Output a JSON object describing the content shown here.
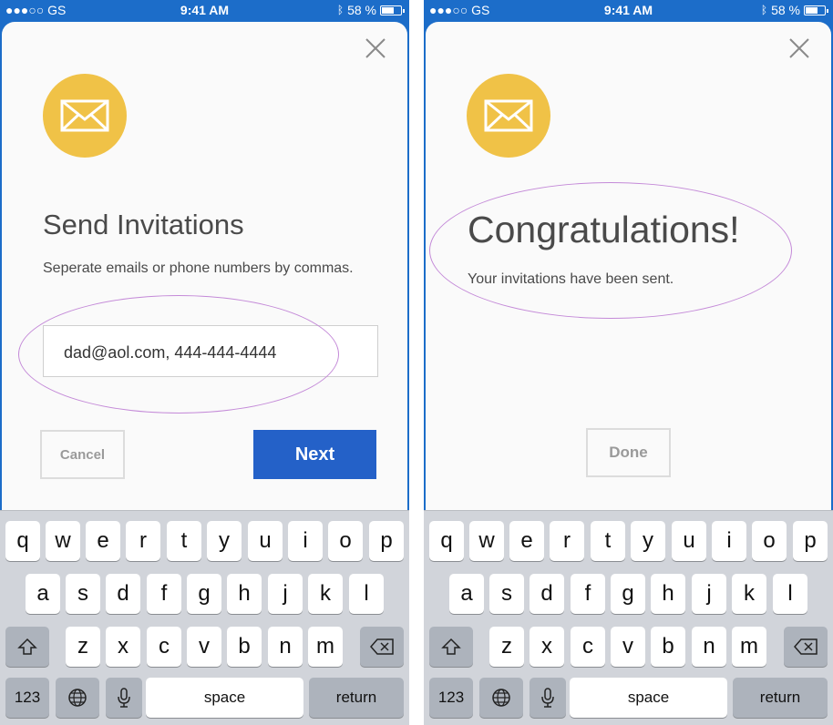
{
  "status_bar": {
    "carrier": "●●●○○ GS",
    "time": "9:41 AM",
    "battery": "58 %",
    "battery_level": 0.58
  },
  "left_screen": {
    "title": "Send Invitations",
    "subtitle": "Seperate emails or phone numbers by commas.",
    "input_value": "dad@aol.com, 444-444-4444",
    "cancel_label": "Cancel",
    "next_label": "Next"
  },
  "right_screen": {
    "title": "Congratulations!",
    "message": "Your invitations have been sent.",
    "done_label": "Done"
  },
  "keyboard": {
    "row1": [
      "q",
      "w",
      "e",
      "r",
      "t",
      "y",
      "u",
      "i",
      "o",
      "p"
    ],
    "row2": [
      "a",
      "s",
      "d",
      "f",
      "g",
      "h",
      "j",
      "k",
      "l"
    ],
    "row3": [
      "z",
      "x",
      "c",
      "v",
      "b",
      "n",
      "m"
    ],
    "numbers_label": "123",
    "space_label": "space",
    "return_label": "return"
  },
  "colors": {
    "status_bar": "#1c6dc9",
    "mail_circle": "#f0c247",
    "next_button": "#2461c8",
    "highlight_oval": "#c48ad8"
  }
}
